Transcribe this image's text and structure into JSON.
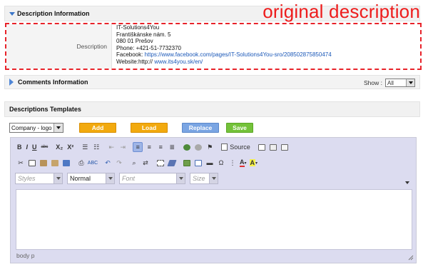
{
  "sections": {
    "description_info": {
      "title": "Description Information"
    },
    "comments_info": {
      "title": "Comments Information",
      "show_label": "Show :",
      "show_value": "All"
    },
    "templates": {
      "title": "Descriptions Templates"
    }
  },
  "overlay_label": "original description",
  "description": {
    "label": "Description",
    "lines": {
      "l1": "IT-Solutions4You",
      "l2": "Františkánske nám. 5",
      "l3": "080 01 Prešov",
      "l4": "Phone: +421-51-7732370",
      "l5_prefix": "Facebook: ",
      "l5_link": "https://www.facebook.com/pages/IT-Solutions4You-sro/208502875850474",
      "l6_prefix": "Website:http:// ",
      "l6_link": "www.its4you.sk/en/"
    }
  },
  "template_controls": {
    "select_value": "Company - logo",
    "add": "Add",
    "load": "Load",
    "replace": "Replace",
    "save": "Save"
  },
  "editor": {
    "toolbar": {
      "bold": "B",
      "italic": "I",
      "underline": "U",
      "strike": "abc",
      "sub": "X₂",
      "sup": "X²",
      "source": "Source",
      "font_color": "A",
      "bg_color": "A"
    },
    "combos": {
      "styles": "Styles",
      "format": "Normal",
      "font": "Font",
      "size": "Size"
    },
    "path": "body  p"
  },
  "colors": {
    "accent_red": "#e8232a",
    "btn_orange": "#f2aa0f",
    "btn_blue": "#7aa5e3",
    "btn_green": "#74c23a",
    "editor_bg": "#dcdcf0",
    "link": "#1b58b8"
  }
}
